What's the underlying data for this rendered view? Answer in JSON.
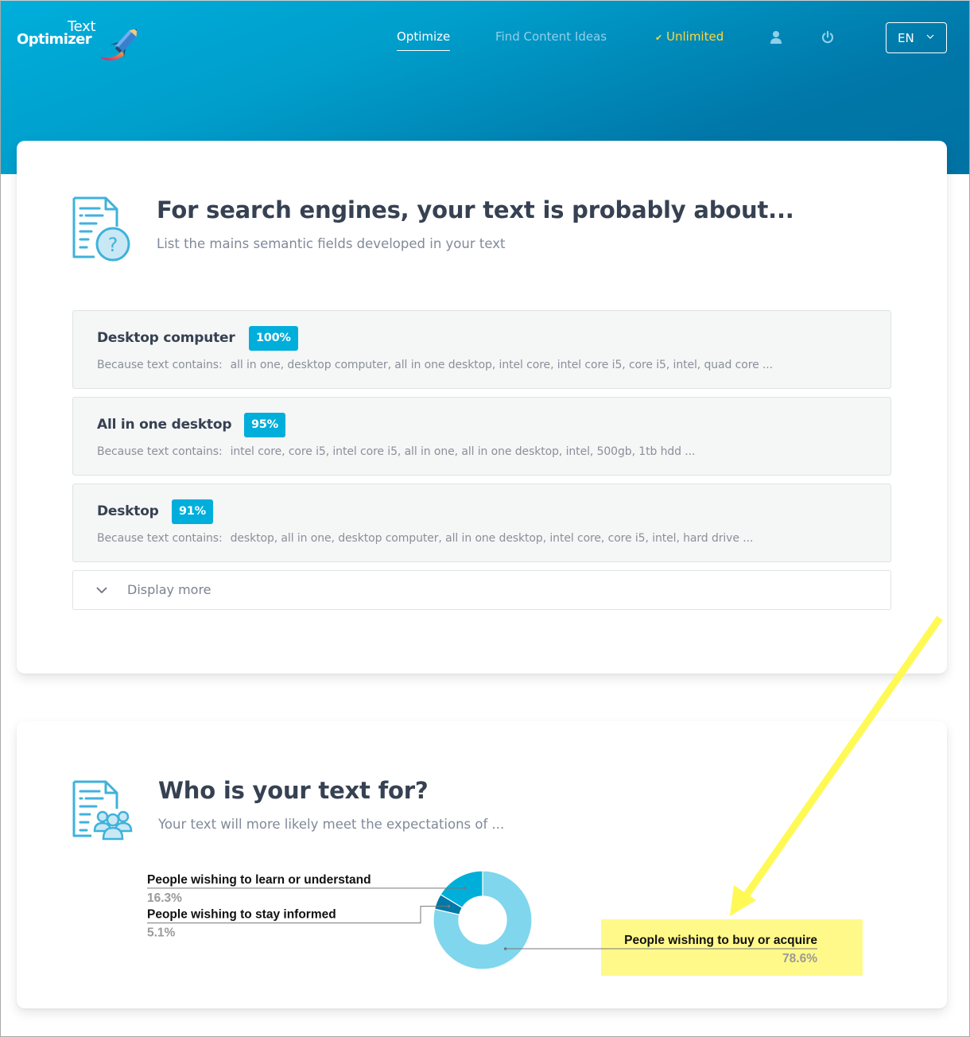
{
  "header": {
    "logo": {
      "line1": "Text",
      "line2": "Optimizer",
      "icon": "rocket-pencil-icon"
    },
    "nav": [
      {
        "label": "Optimize",
        "active": true
      },
      {
        "label": "Find Content Ideas",
        "active": false
      },
      {
        "label": "Unlimited",
        "check_icon": "✔"
      }
    ],
    "icons": {
      "user": "user-icon",
      "power": "power-icon"
    },
    "language": {
      "selected": "EN",
      "icon": "chevron-down-icon"
    },
    "colors": {
      "gradient_start": "#00aedb",
      "gradient_end": "#0072a3",
      "unlimited": "#ffd83a",
      "inactive_link": "#8fd0ea"
    }
  },
  "semantic_section": {
    "icon": "document-question-icon",
    "title": "For search engines, your text is probably about...",
    "subtitle": "List the mains semantic fields developed in your text",
    "reason_prefix": "Because text contains:",
    "fields": [
      {
        "name": "Desktop computer",
        "score": "100%",
        "terms": "all in one, desktop computer, all in one desktop, intel core, intel core i5, core i5, intel, quad core ..."
      },
      {
        "name": "All in one desktop",
        "score": "95%",
        "terms": "intel core, core i5, intel core i5, all in one, all in one desktop, intel, 500gb, 1tb hdd ..."
      },
      {
        "name": "Desktop",
        "score": "91%",
        "terms": "desktop, all in one, desktop computer, all in one desktop, intel core, core i5, intel, hard drive ..."
      }
    ],
    "display_more": "Display more",
    "badge_color": "#00aedb"
  },
  "audience_section": {
    "icon": "document-people-icon",
    "title": "Who is your text for?",
    "subtitle": "Your text will more likely meet the expectations of ...",
    "highlight_color": "#fff98a",
    "annotation_arrow_color": "#fff955"
  },
  "chart_data": {
    "type": "pie",
    "variant": "donut",
    "title": "",
    "slices": [
      {
        "label": "People wishing to learn or understand",
        "value": 16.3,
        "display": "16.3%",
        "color": "#00afd9"
      },
      {
        "label": "People wishing to stay informed",
        "value": 5.1,
        "display": "5.1%",
        "color": "#0078a8"
      },
      {
        "label": "People wishing to buy or acquire",
        "value": 78.6,
        "display": "78.6%",
        "color": "#80d6ec",
        "highlighted": true
      }
    ],
    "start_angle": "12 o'clock",
    "direction": "clockwise-from-largest",
    "legend": "callout-labels"
  }
}
